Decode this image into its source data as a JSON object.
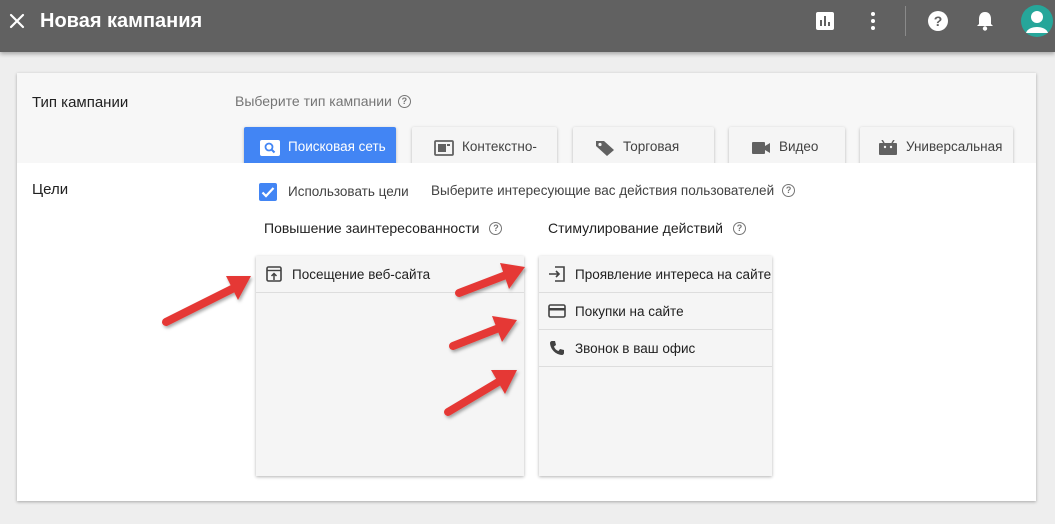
{
  "topbar": {
    "title": "Новая кампания",
    "icons": [
      "close-icon",
      "chart-icon",
      "more-vert-icon",
      "help-icon",
      "bell-icon",
      "avatar"
    ]
  },
  "campaign_type": {
    "label": "Тип кампании",
    "hint": "Выберите тип кампании",
    "options": [
      {
        "label": "Поисковая сеть",
        "icon": "search-icon",
        "selected": true
      },
      {
        "label": "Контекстно-",
        "icon": "display-icon",
        "selected": false
      },
      {
        "label": "Торговая",
        "icon": "tag-icon",
        "selected": false
      },
      {
        "label": "Видео",
        "icon": "video-icon",
        "selected": false
      },
      {
        "label": "Универсальная",
        "icon": "android-icon",
        "selected": false
      }
    ]
  },
  "goals": {
    "label": "Цели",
    "use_goals_label": "Использовать цели",
    "use_goals_checked": true,
    "hint": "Выберите интересующие вас действия пользователей",
    "awareness": {
      "title": "Повышение заинтересованности",
      "items": [
        {
          "label": "Посещение веб-сайта",
          "icon": "open-in-browser-icon"
        }
      ]
    },
    "action": {
      "title": "Стимулирование действий",
      "items": [
        {
          "label": "Проявление интереса на сайте",
          "icon": "sign-in-icon"
        },
        {
          "label": "Покупки на сайте",
          "icon": "credit-card-icon"
        },
        {
          "label": "Звонок в ваш офис",
          "icon": "phone-icon"
        }
      ]
    }
  },
  "colors": {
    "topbar": "#616161",
    "accent": "#4285f4",
    "annotation_arrow": "#e53935",
    "avatar": "#26a69a"
  }
}
